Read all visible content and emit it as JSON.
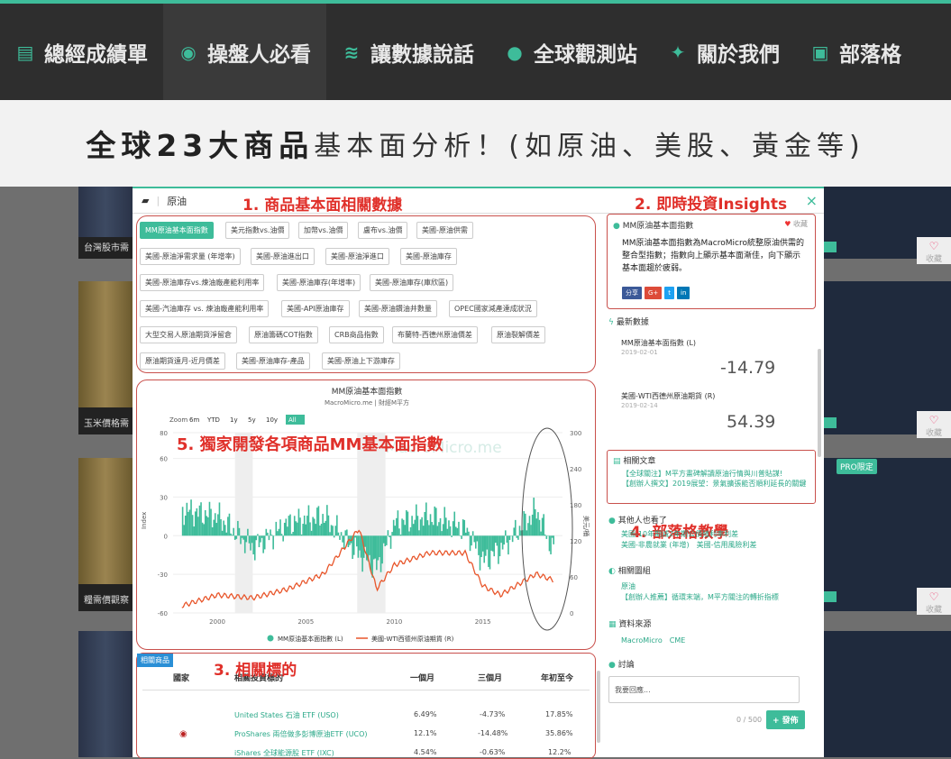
{
  "nav": {
    "items": [
      {
        "label": "總經成績單",
        "icon": "document-icon"
      },
      {
        "label": "操盤人必看",
        "icon": "eye-icon"
      },
      {
        "label": "讓數據說話",
        "icon": "database-icon"
      },
      {
        "label": "全球觀測站",
        "icon": "globe-icon"
      },
      {
        "label": "關於我們",
        "icon": "users-icon"
      },
      {
        "label": "部落格",
        "icon": "rss-icon"
      }
    ]
  },
  "banner": {
    "bold": "全球23大商品",
    "normal": "基本面分析！(如原油、美股、黃金等)"
  },
  "background": {
    "card1": "台灣股市需",
    "card2": "玉米價格需",
    "card3": "糧需價觀察",
    "fav": "收藏",
    "pro": "PRO限定"
  },
  "modal": {
    "breadcrumb": "原油",
    "close": "×",
    "annotations": {
      "a1": "1. 商品基本面相關數據",
      "a2": "2. 即時投資Insights",
      "a3": "3. 相關標的",
      "a4": "4. 部落格教學",
      "a5": "5. 獨家開發各項商品MM基本面指數"
    },
    "tags": [
      "MM原油基本面指數",
      "美元指數vs.油價",
      "加幣vs.油價",
      "盧布vs.油價",
      "美國-原油供需",
      "美國-原油淨需求量 (年增率)",
      "美國-原油進出口",
      "美國-原油淨進口",
      "美國-原油庫存",
      "美國-原油庫存vs.煉油廠產能利用率",
      "美國-原油庫存(年增率)",
      "美國-原油庫存(庫欣區)",
      "美國-汽油庫存 vs. 煉油廠產能利用率",
      "美國-API原油庫存",
      "美國-原油鑽油井數量",
      "OPEC國家減產達成狀況",
      "大型交易人原油期貨淨留倉",
      "原油籌碼COT指數",
      "CRB商品指數",
      "布蘭特-西德州原油價差",
      "原油裂解價差",
      "原油期貨遠月-近月價差",
      "美國-原油庫存-產品",
      "美國-原油上下游庫存"
    ],
    "chart": {
      "title": "MM原油基本面指數",
      "subtitle": "MacroMicro.me | 財經M平方",
      "zoom_label": "Zoom",
      "zoom_options": [
        "6m",
        "YTD",
        "1y",
        "5y",
        "10y",
        "All"
      ],
      "watermark": "MacroMicro.me",
      "left_ticks": [
        "80",
        "60",
        "30",
        "0",
        "-30",
        "-60"
      ],
      "right_ticks": [
        "300",
        "240",
        "180",
        "120",
        "60",
        "0"
      ],
      "x_ticks": [
        "2000",
        "2005",
        "2010",
        "2015"
      ],
      "left_axis": "Index",
      "right_axis": "美元/桶",
      "legend1": "MM原油基本面指數 (L)",
      "legend2": "美國-WTI西德州原油期貨 (R)"
    },
    "table": {
      "badge": "相關商品",
      "headers": [
        "國家",
        "相關投資標的",
        "一個月",
        "三個月",
        "年初至今"
      ],
      "rows": [
        {
          "name": "United States 石油 ETF (USO)",
          "m1": "6.49%",
          "m3": "-4.73%",
          "ytd": "17.85%"
        },
        {
          "name": "ProShares 兩倍做多彭博原油ETF (UCO)",
          "m1": "12.1%",
          "m3": "-14.48%",
          "ytd": "35.86%"
        },
        {
          "name": "iShares 全球能源股 ETF (IXC)",
          "m1": "4.54%",
          "m3": "-0.63%",
          "ytd": "12.2%"
        }
      ]
    },
    "side": {
      "insight_title": "MM原油基本面指數",
      "insight_fav": "收藏",
      "insight_text": "MM原油基本面指數為MacroMicro統整原油供需的整合型指數；指數向上顯示基本面漸佳，向下顯示基本面趨於疲弱。",
      "share_fb": "分享",
      "share_gp": "G+",
      "share_tw": "t",
      "share_in": "in",
      "latest_title": "最新數據",
      "latest": [
        {
          "name": "MM原油基本面指數 (L)",
          "date": "2019-02-01",
          "value": "-14.79"
        },
        {
          "name": "美國-WTI西德州原油期貨 (R)",
          "date": "2019-02-14",
          "value": "54.39"
        }
      ],
      "articles_title": "相關文章",
      "articles": [
        "【全球關注】M平方畫碑解讀原油行情與川普貼謀!",
        "【創辦人撰文】2019展望：景氣擴張能否順利延長的關鍵"
      ],
      "others_title": "其他人也看了",
      "others": [
        "美國-10年期減2年期公債殖利率利差",
        "美國-非農就業 (年增)　美國-信用風險利差"
      ],
      "groups_title": "相關圖組",
      "groups": [
        "原油",
        "【創辦人推薦】循環末端，M平方關注的轉折指標"
      ],
      "source_title": "資料來源",
      "sources": "MacroMicro　CME",
      "discuss_title": "討論",
      "comment_placeholder": "我要回應...",
      "count": "0 / 500",
      "post": "+ 發佈"
    }
  },
  "chart_data": {
    "type": "line",
    "title": "MM原油基本面指數",
    "x": [
      1998,
      2000,
      2002,
      2004,
      2006,
      2008,
      2009,
      2010,
      2012,
      2014,
      2015,
      2016,
      2018,
      2019
    ],
    "series": [
      {
        "name": "MM原油基本面指數 (L)",
        "values": [
          20,
          15,
          -10,
          10,
          15,
          -15,
          -25,
          10,
          15,
          5,
          -20,
          -10,
          20,
          -14.79
        ]
      },
      {
        "name": "美國-WTI西德州原油期貨 (R)",
        "values": [
          12,
          30,
          25,
          40,
          65,
          140,
          40,
          80,
          100,
          100,
          45,
          30,
          65,
          54.39
        ]
      }
    ],
    "ylim_left": [
      -60,
      80
    ],
    "ylim_right": [
      0,
      300
    ]
  }
}
